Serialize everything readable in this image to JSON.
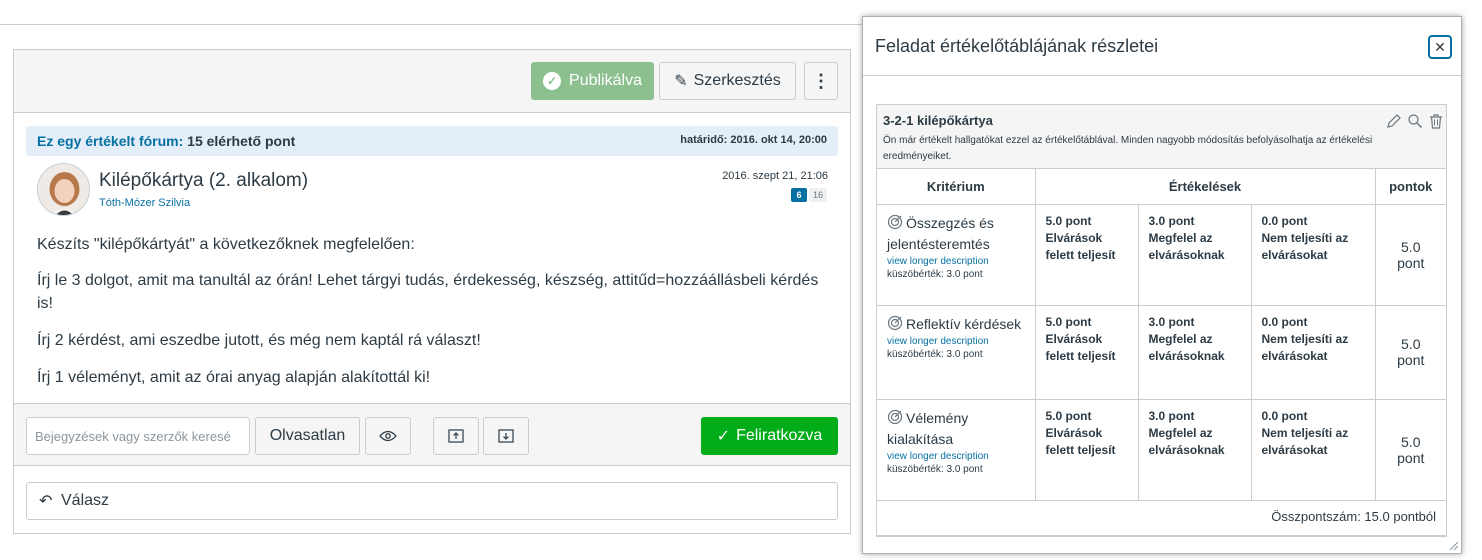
{
  "discussion": {
    "published_label": "Publikálva",
    "edit_label": "Szerkesztés",
    "more_label": "⋮",
    "graded_prefix": "Ez egy értékelt fórum:",
    "graded_points": "15 elérhető pont",
    "due": "határidő: 2016. okt 14, 20:00",
    "title": "Kilépőkártya (2. alkalom)",
    "author": "Tóth-Mózer Szilvia",
    "date": "2016. szept 21, 21:06",
    "unread_count": "6",
    "total_count": "16",
    "paragraphs": [
      "Készíts \"kilépőkártyát\" a következőknek megfelelően:",
      "Írj le 3 dolgot, amit ma tanultál az órán! Lehet tárgyi tudás, érdekesség, készség, attitűd=hozzáállásbeli kérdés is!",
      "Írj 2 kérdést, ami eszedbe jutott, és még nem kaptál rá választ!",
      "Írj 1 véleményt, amit az órai anyag alapján alakítottál ki!"
    ],
    "search_placeholder": "Bejegyzések vagy szerzők keresé",
    "unread_label": "Olvasatlan",
    "subscribed_label": "Feliratkozva",
    "reply_label": "Válasz"
  },
  "dialog": {
    "title": "Feladat értékelőtáblájának részletei",
    "rubric_name": "3-2-1 kilépőkártya",
    "rubric_warning": "Ön már értékelt hallgatókat ezzel az értékelőtáblával. Minden nagyobb módosítás befolyásolhatja az értékelési eredményeiket.",
    "col_criterion": "Kritérium",
    "col_ratings": "Értékelések",
    "col_points": "pontok",
    "criteria": [
      {
        "name": "Összegzés és jelentésteremtés",
        "link": "view longer description",
        "threshold": "küszöbérték: 3.0 pont",
        "ratings": [
          {
            "pts": "5.0 pont",
            "desc": "Elvárások felett teljesít"
          },
          {
            "pts": "3.0 pont",
            "desc": "Megfelel az elvárásoknak"
          },
          {
            "pts": "0.0 pont",
            "desc": "Nem teljesíti az elvárásokat"
          }
        ],
        "points": "5.0 pont"
      },
      {
        "name": "Reflektív kérdések",
        "link": "view longer description",
        "threshold": "küszöbérték: 3.0 pont",
        "ratings": [
          {
            "pts": "5.0 pont",
            "desc": "Elvárások felett teljesít"
          },
          {
            "pts": "3.0 pont",
            "desc": "Megfelel az elvárásoknak"
          },
          {
            "pts": "0.0 pont",
            "desc": "Nem teljesíti az elvárásokat"
          }
        ],
        "points": "5.0 pont"
      },
      {
        "name": "Vélemény kialakítása",
        "link": "view longer description",
        "threshold": "küszöbérték: 3.0 pont",
        "ratings": [
          {
            "pts": "5.0 pont",
            "desc": "Elvárások felett teljesít"
          },
          {
            "pts": "3.0 pont",
            "desc": "Megfelel az elvárásoknak"
          },
          {
            "pts": "0.0 pont",
            "desc": "Nem teljesíti az elvárásokat"
          }
        ],
        "points": "5.0 pont"
      }
    ],
    "total": "Összpontszám: 15.0 pontból"
  },
  "colors": {
    "link_blue": "#0770a3",
    "published_green": "#8cc08e",
    "subscribed_green": "#00ac18",
    "graded_bar_bg": "#e3eef8"
  }
}
